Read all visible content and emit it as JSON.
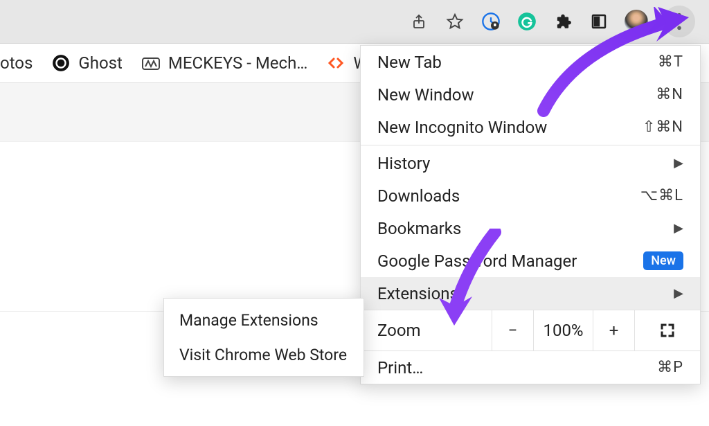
{
  "bookmarks": {
    "items": [
      {
        "label": "otos"
      },
      {
        "label": "Ghost"
      },
      {
        "label": "MECKEYS - Mech…"
      },
      {
        "label": "W"
      }
    ]
  },
  "menu": {
    "new_tab": {
      "label": "New Tab",
      "shortcut": "⌘T"
    },
    "new_window": {
      "label": "New Window",
      "shortcut": "⌘N"
    },
    "new_incognito": {
      "label": "New Incognito Window",
      "shortcut": "⇧⌘N"
    },
    "history": {
      "label": "History"
    },
    "downloads": {
      "label": "Downloads",
      "shortcut": "⌥⌘L"
    },
    "bookmarks": {
      "label": "Bookmarks"
    },
    "password_manager": {
      "label": "Google Password Manager",
      "badge": "New"
    },
    "extensions": {
      "label": "Extensions"
    },
    "zoom": {
      "label": "Zoom",
      "minus": "−",
      "value": "100%",
      "plus": "+"
    },
    "print": {
      "label": "Print…",
      "shortcut": "⌘P"
    }
  },
  "submenu": {
    "manage": "Manage Extensions",
    "store": "Visit Chrome Web Store"
  }
}
